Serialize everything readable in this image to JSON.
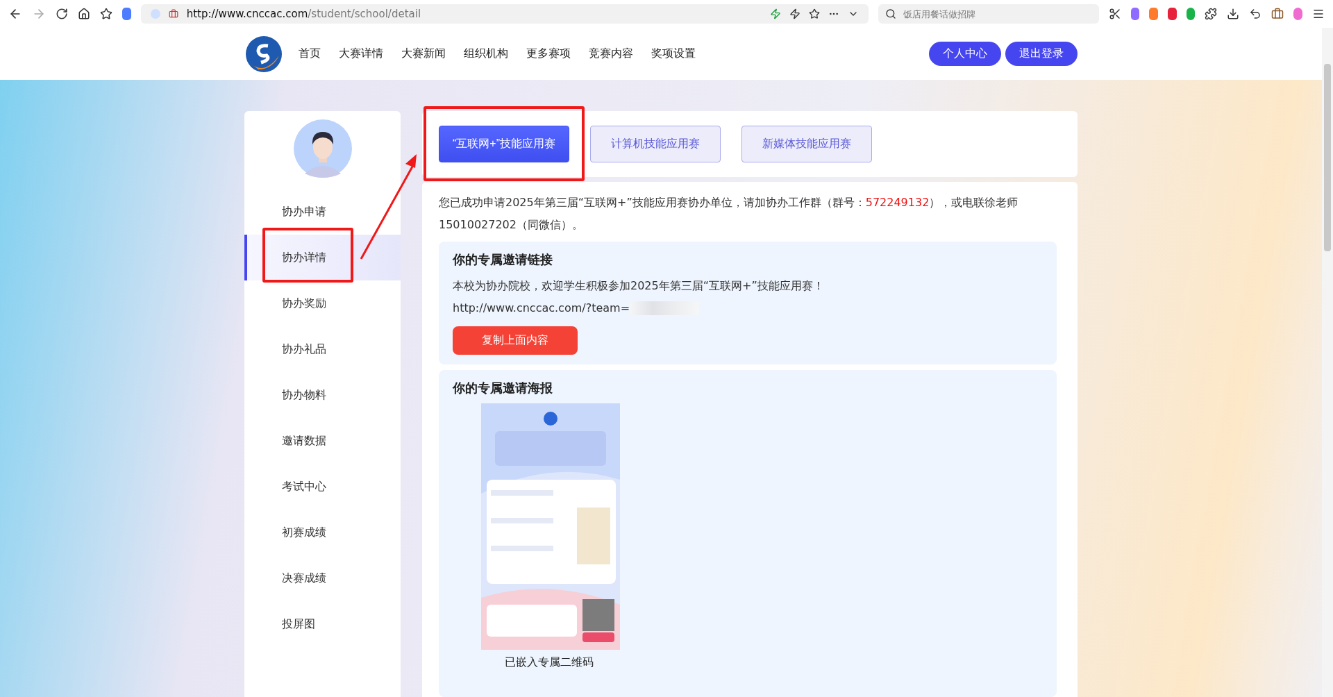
{
  "browser": {
    "url_host": "http://www.cnccac.com",
    "url_path": "/student/school/detail",
    "search": {
      "placeholder": "饭店用餐话做招牌"
    }
  },
  "nav": {
    "items": [
      "首页",
      "大赛详情",
      "大赛新闻",
      "组织机构",
      "更多赛项",
      "竞赛内容",
      "奖项设置"
    ],
    "buttons": [
      "个人中心",
      "退出登录"
    ]
  },
  "sidebar": {
    "items": [
      {
        "label": "协办申请",
        "selected": false,
        "highlighted": false
      },
      {
        "label": "协办详情",
        "selected": true,
        "highlighted": true
      },
      {
        "label": "协办奖励",
        "selected": false,
        "highlighted": false
      },
      {
        "label": "协办礼品",
        "selected": false,
        "highlighted": false
      },
      {
        "label": "协办物料",
        "selected": false,
        "highlighted": false
      },
      {
        "label": "邀请数据",
        "selected": false,
        "highlighted": false
      },
      {
        "label": "考试中心",
        "selected": false,
        "highlighted": false
      },
      {
        "label": "初赛成绩",
        "selected": false,
        "highlighted": false
      },
      {
        "label": "决赛成绩",
        "selected": false,
        "highlighted": false
      },
      {
        "label": "投屏图",
        "selected": false,
        "highlighted": false
      }
    ]
  },
  "tabs": [
    {
      "label": "“互联网+”技能应用赛",
      "selected": true,
      "highlighted": true
    },
    {
      "label": "计算机技能应用赛",
      "selected": false,
      "highlighted": false
    },
    {
      "label": "新媒体技能应用赛",
      "selected": false,
      "highlighted": false
    }
  ],
  "notice": {
    "before": "您已成功申请2025年第三届“互联网+”技能应用赛协办单位，请加协办工作群（群号：",
    "group_number": "572249132",
    "after": "），或电联徐老师15010027202（同微信）。"
  },
  "invite_link": {
    "title": "你的专属邀请链接",
    "text": "本校为协办院校，欢迎学生积极参加2025年第三届“互联网+”技能应用赛！",
    "url": "http://www.cnccac.com/?team=",
    "button": "复制上面内容"
  },
  "invite_poster": {
    "title": "你的专属邀请海报",
    "caption": "已嵌入专属二维码"
  }
}
